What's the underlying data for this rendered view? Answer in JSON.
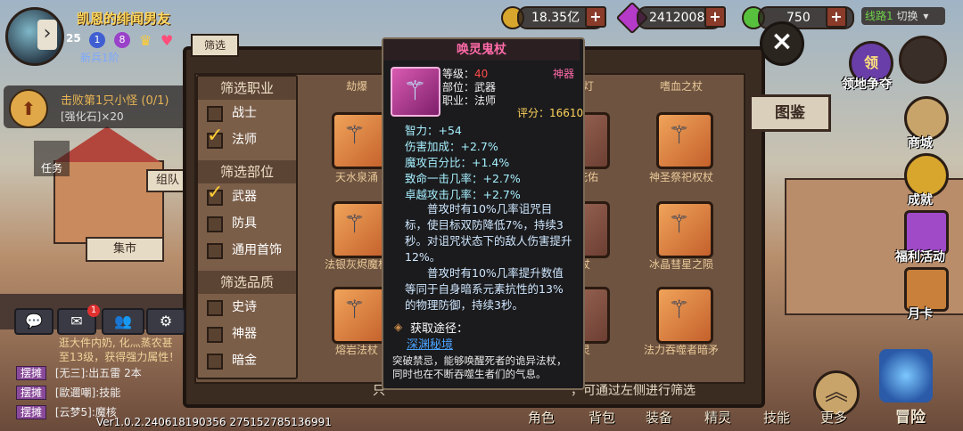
{
  "player": {
    "name": "凯恩的绯闻男友",
    "level": "25",
    "badge1": "1",
    "badge2": "8",
    "rank": "新兵1阶"
  },
  "resources": [
    {
      "icon": "gold-coin-icon",
      "value": "18.35亿"
    },
    {
      "icon": "purple-diamond-icon",
      "value": "2412008"
    },
    {
      "icon": "green-heart-icon",
      "value": "750"
    }
  ],
  "line_switch": {
    "label": "线路1",
    "action": "切换"
  },
  "quest": {
    "title": "击败第1只小怪",
    "progress": "(0/1)",
    "reward": "[强化石]×20"
  },
  "left_tabs": {
    "task": "任务",
    "team": "组队",
    "market": "集市"
  },
  "panel": {
    "tab_label": "筛选",
    "filter_groups": [
      {
        "title": "筛选职业",
        "items": [
          {
            "label": "战士",
            "checked": false
          },
          {
            "label": "法师",
            "checked": true
          }
        ]
      },
      {
        "title": "筛选部位",
        "items": [
          {
            "label": "武器",
            "checked": true
          },
          {
            "label": "防具",
            "checked": false
          },
          {
            "label": "通用首饰",
            "checked": false
          }
        ]
      },
      {
        "title": "筛选品质",
        "items": [
          {
            "label": "史诗",
            "checked": false
          },
          {
            "label": "神器",
            "checked": false
          },
          {
            "label": "暗金",
            "checked": false
          }
        ]
      }
    ],
    "column_headers": [
      "劫爆",
      "灯",
      "嗜血之杖"
    ],
    "items": [
      {
        "label": "天水泉涌"
      },
      {
        "label": "万物庇佑"
      },
      {
        "label": "神圣祭祀权杖"
      },
      {
        "label": "法银灰烬魔杖"
      },
      {
        "label": "杖"
      },
      {
        "label": "冰晶彗星之陨"
      },
      {
        "label": "熔岩法杖"
      },
      {
        "label": "灵"
      },
      {
        "label": "法力吞噬者暗矛"
      }
    ],
    "footer_hint": "只 … 通过左侧进行筛选",
    "footer_hint_parts": [
      "只",
      "，可通过左侧进行筛选"
    ]
  },
  "tooltip": {
    "name": "唤灵鬼杖",
    "quality": "神器",
    "level_label": "等级：",
    "level_value": "40",
    "slot": "部位：武器",
    "job": "职业：法师",
    "score_label": "评分：",
    "score_value": "16610",
    "attributes": [
      "智力：+54",
      "伤害加成：+2.7%",
      "魔攻百分比：+1.4%",
      "致命一击几率：+2.7%",
      "卓越攻击几率：+2.7%"
    ],
    "effects": [
      "普攻时有10%几率诅咒目标，使目标双防降低7%，持续3秒。",
      "对诅咒状态下的敌人伤害提升12%。",
      "普攻时有10%几率提升数值等同于自身暗系元素抗性的13%的物理防御，持续3秒。"
    ],
    "source_label": "获取途径：",
    "source_link": "深渊秘境",
    "flavor": "突破禁忌，能够唤醒死者的诡异法杖，同时也在不断吞噬生者们的气息。"
  },
  "chat": {
    "lines": [
      "逛大件内奶, 化灬蒸农甚",
      "至13级，获得强力属性！"
    ],
    "stall_rows": [
      {
        "tag": "摆摊",
        "text": "[无三]:出五雷 2本"
      },
      {
        "tag": "摆摊",
        "text": "[歐邇嘲]:技能"
      },
      {
        "tag": "摆摊",
        "text": "[云梦5]:魔核"
      }
    ],
    "badge_count": "1"
  },
  "right_menu": {
    "territory": "领地争夺",
    "shop": "商城",
    "achievement": "成就",
    "welfare": "福利活动",
    "monthly": "月卡",
    "gallery": "图鉴",
    "territory_icon_text": "领"
  },
  "bottom_nav": [
    "角色",
    "背包",
    "装备",
    "精灵",
    "技能",
    "更多",
    "冒险"
  ],
  "version": "Ver1.0.2.240618190356 275152785136991"
}
